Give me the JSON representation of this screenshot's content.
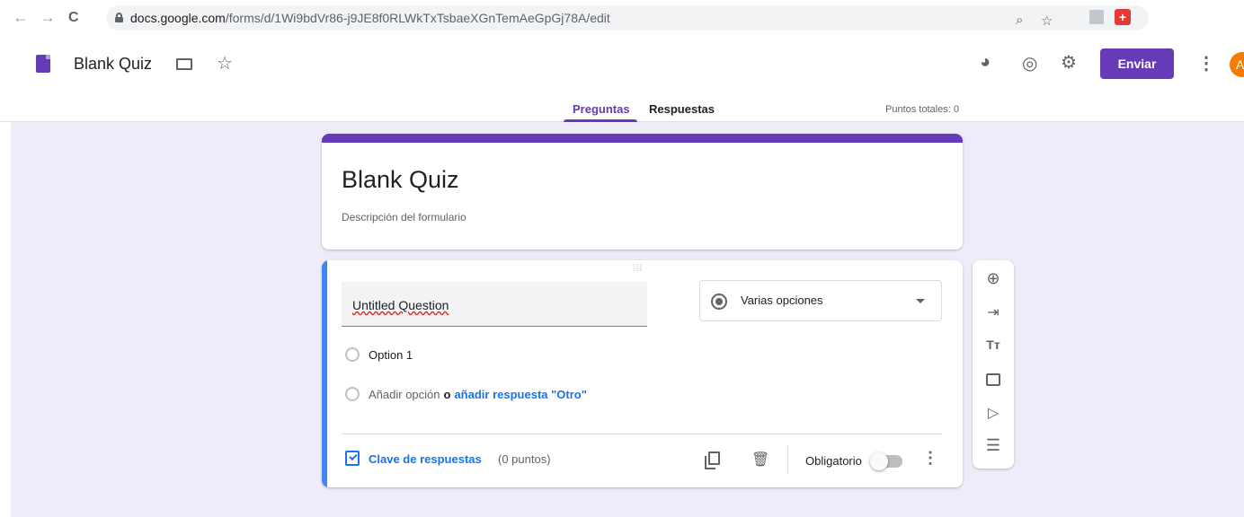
{
  "browser": {
    "url_domain": "docs.google.com",
    "url_path": "/forms/d/1Wi9bdVr86-j9JE8f0RLWkTxTsbaeXGnTemAeGpGj78A/edit",
    "icons": {
      "back": "←",
      "forward": "→",
      "reload": "C",
      "zoom": "⌕",
      "star": "☆",
      "pdf": "⬛",
      "ext": "+"
    }
  },
  "header": {
    "title": "Blank Quiz",
    "send_label": "Enviar",
    "avatar_letter": "A",
    "icons": {
      "star": "☆",
      "palette": "◕",
      "preview": "◎",
      "settings": "⚙",
      "more": "⋮"
    }
  },
  "tabs": [
    {
      "label": "Preguntas",
      "active": true
    },
    {
      "label": "Respuestas",
      "active": false
    }
  ],
  "points_total": "Puntos totales: 0",
  "form": {
    "title": "Blank Quiz",
    "description": "Descripción del formulario",
    "accent": "#673ab7"
  },
  "question": {
    "drag_handle": "⁞⁞⁞",
    "text": "Untitled Question",
    "type": "Varias opciones",
    "options": [
      "Option 1"
    ],
    "add_option": "Añadir opción",
    "conjunction": "o",
    "add_other": "añadir respuesta \"Otro\"",
    "answer_key": "Clave de respuestas",
    "answer_points": "(0 puntos)",
    "required_label": "Obligatorio",
    "required": false,
    "icons": {
      "trash": "🗑",
      "more": "⋮"
    }
  },
  "toolbar": {
    "icons": [
      "⊕",
      "⇥",
      "Tт",
      "▣",
      "▷",
      "☰"
    ]
  }
}
